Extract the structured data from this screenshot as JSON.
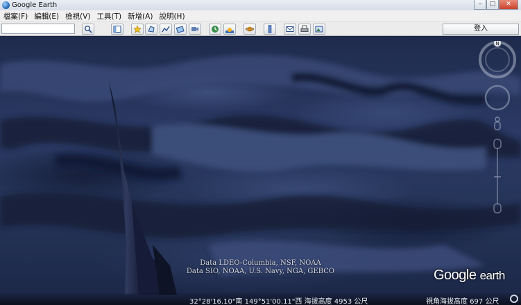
{
  "window": {
    "title": "Google Earth",
    "minimize_glyph": "–",
    "maximize_glyph": "□",
    "close_glyph": "✕"
  },
  "menu": {
    "items": [
      {
        "label": "檔案(F)"
      },
      {
        "label": "編輯(E)"
      },
      {
        "label": "檢視(V)"
      },
      {
        "label": "工具(T)"
      },
      {
        "label": "新增(A)"
      },
      {
        "label": "說明(H)"
      }
    ]
  },
  "toolbar": {
    "search_value": "",
    "sign_in_label": "登入",
    "buttons": [
      "search-icon",
      "sidebar-toggle-icon",
      "placemark-icon",
      "polygon-icon",
      "path-icon",
      "overlay-icon",
      "tour-icon",
      "historical-imagery-icon",
      "sunlight-icon",
      "planets-icon",
      "ruler-icon",
      "email-icon",
      "print-icon",
      "save-image-icon"
    ]
  },
  "viewport": {
    "attribution_lines": [
      "Data LDEO-Columbia, NSF, NOAA",
      "Data SIO, NOAA, U.S. Navy, NGA, GEBCO"
    ],
    "brand_google": "Google",
    "brand_earth": "earth",
    "compass_north": "N"
  },
  "statusbar": {
    "coordinates": "32°28'16.10\"南  149°51'00.11\"西  海拔高度  4953 公尺",
    "eye_altitude": "視角海拔高度      697 公尺"
  },
  "colors": {
    "ocean_floor": "#2b3a64",
    "titlebar": "#d6dde8",
    "menubar": "#f0f0f0"
  }
}
